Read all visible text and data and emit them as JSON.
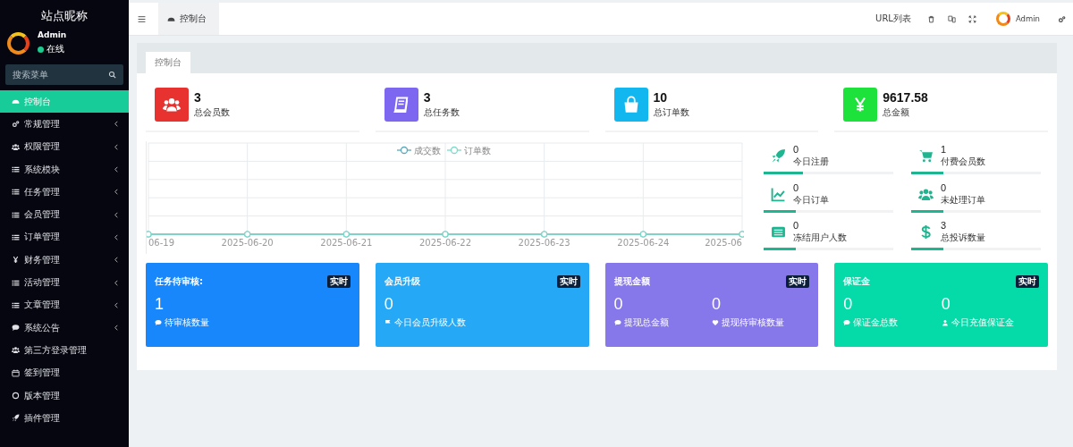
{
  "sidebar": {
    "site_name": "站点昵称",
    "user": {
      "name": "Admin",
      "status": "在线",
      "online": true
    },
    "search": {
      "placeholder": "搜索菜单"
    },
    "items": [
      {
        "label": "控制台",
        "selected": true,
        "has_submenu": false
      },
      {
        "label": "常规管理",
        "selected": false,
        "has_submenu": true
      },
      {
        "label": "权限管理",
        "selected": false,
        "has_submenu": true
      },
      {
        "label": "系统模块",
        "selected": false,
        "has_submenu": true
      },
      {
        "label": "任务管理",
        "selected": false,
        "has_submenu": true
      },
      {
        "label": "会员管理",
        "selected": false,
        "has_submenu": true
      },
      {
        "label": "订单管理",
        "selected": false,
        "has_submenu": true
      },
      {
        "label": "财务管理",
        "selected": false,
        "has_submenu": true
      },
      {
        "label": "活动管理",
        "selected": false,
        "has_submenu": true
      },
      {
        "label": "文章管理",
        "selected": false,
        "has_submenu": true
      },
      {
        "label": "系统公告",
        "selected": false,
        "has_submenu": true
      },
      {
        "label": "第三方登录管理",
        "selected": false,
        "has_submenu": false
      },
      {
        "label": "签到管理",
        "selected": false,
        "has_submenu": false
      },
      {
        "label": "版本管理",
        "selected": false,
        "has_submenu": false
      },
      {
        "label": "插件管理",
        "selected": false,
        "has_submenu": false
      }
    ]
  },
  "topbar": {
    "tabs": [
      {
        "label": "控制台",
        "selected": true
      }
    ],
    "url_link": "URL列表",
    "user_name": "Admin"
  },
  "panel": {
    "tabs": [
      {
        "label": "控制台",
        "selected": true
      }
    ],
    "stats": [
      {
        "value": "3",
        "label": "总会员数",
        "color": "#e8322f"
      },
      {
        "value": "3",
        "label": "总任务数",
        "color": "#7d67f0"
      },
      {
        "value": "10",
        "label": "总订单数",
        "color": "#12b7f0"
      },
      {
        "value": "9617.58",
        "label": "总金额",
        "color": "#1ee23c"
      }
    ],
    "chart": {
      "x_labels": [
        "06-19",
        "2025-06-20",
        "2025-06-21",
        "2025-06-22",
        "2025-06-23",
        "2025-06-24",
        "2025-06"
      ],
      "legend": [
        {
          "name": "成交数",
          "color": "#5aa9b8"
        },
        {
          "name": "订单数",
          "color": "#7fd8c8"
        }
      ]
    },
    "mini_stats": [
      {
        "value": "0",
        "label": "今日注册",
        "level": 0.3
      },
      {
        "value": "1",
        "label": "付费会员数",
        "level": 0.25
      },
      {
        "value": "0",
        "label": "今日订单",
        "level": 0.25
      },
      {
        "value": "0",
        "label": "未处理订单",
        "level": 0.25
      },
      {
        "value": "0",
        "label": "冻结用户人数",
        "level": 0.25
      },
      {
        "value": "3",
        "label": "总投诉数量",
        "level": 0.25
      }
    ],
    "cards": [
      {
        "title": "任务待审核:",
        "badge": "实时",
        "color": "#1887fb",
        "metrics": [
          {
            "value": "1",
            "label": "待审核数量"
          }
        ]
      },
      {
        "title": "会员升级",
        "badge": "实时",
        "color": "#25a9f7",
        "metrics": [
          {
            "value": "0",
            "label": "今日会员升级人数"
          }
        ]
      },
      {
        "title": "提现金额",
        "badge": "实时",
        "color": "#8677ea",
        "metrics": [
          {
            "value": "0",
            "label": "提现总金额"
          },
          {
            "value": "0",
            "label": "提现待审核数量"
          }
        ]
      },
      {
        "title": "保证金",
        "badge": "实时",
        "color": "#05dba8",
        "metrics": [
          {
            "value": "0",
            "label": "保证金总数"
          },
          {
            "value": "0",
            "label": "今日充值保证金"
          }
        ]
      }
    ]
  }
}
